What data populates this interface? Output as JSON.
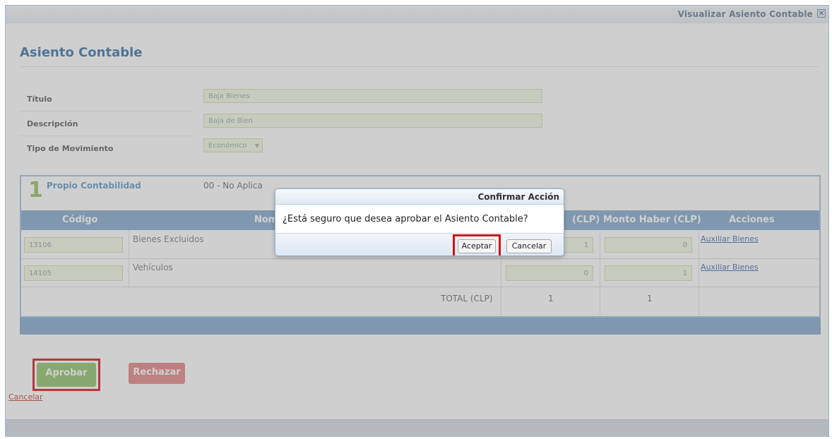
{
  "window": {
    "title": "Visualizar Asiento Contable",
    "close_glyph": "✕"
  },
  "page_title": "Asiento Contable",
  "form": {
    "fields": [
      {
        "label": "Título",
        "value": "Baja Bienes"
      },
      {
        "label": "Descripción",
        "value": "Baja de Bien"
      },
      {
        "label": "Tipo de Movimiento",
        "value": "Económico",
        "arrow": "▼"
      }
    ]
  },
  "section": {
    "number": "1",
    "name": "Propio Contabilidad",
    "cost_center": "00 - No Aplica",
    "columns": [
      "Código",
      "Nombre",
      "Monto Debe (CLP)",
      "Monto Haber (CLP)",
      "Acciones"
    ],
    "visible_column_text": {
      "nombre": "Nomb",
      "debe": "(CLP)"
    },
    "rows": [
      {
        "code": "13106",
        "name": "Bienes Excluidos",
        "debe": "1",
        "haber": "0",
        "action": "Auxiliar Bienes"
      },
      {
        "code": "14105",
        "name": "Vehículos",
        "debe": "0",
        "haber": "1",
        "action": "Auxiliar Bienes"
      }
    ],
    "total_label": "TOTAL (CLP)",
    "total_debe": "1",
    "total_haber": "1"
  },
  "buttons": {
    "approve": "Aprobar",
    "reject": "Rechazar",
    "cancel_link": "Cancelar"
  },
  "dialog": {
    "title": "Confirmar Acción",
    "message": "¿Está seguro que desea aprobar el Asiento Contable?",
    "accept": "Aceptar",
    "cancel": "Cancelar"
  },
  "colors": {
    "accent_blue": "#7fa7cb",
    "approve_green": "#8bc164",
    "reject_red": "#e48282",
    "highlight_red": "#d01010"
  }
}
